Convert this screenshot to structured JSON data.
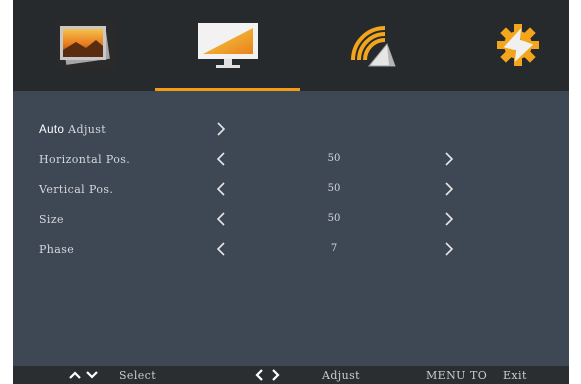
{
  "tabs": [
    {
      "icon": "picture-icon",
      "active": false
    },
    {
      "icon": "display-icon",
      "active": true
    },
    {
      "icon": "signal-icon",
      "active": false
    },
    {
      "icon": "settings-gear-icon",
      "active": false
    }
  ],
  "accent_color": "#f39c1a",
  "menu": {
    "auto_adjust": {
      "label_bold": "Auto",
      "label_rest": " Adjust"
    },
    "items": [
      {
        "label": "Horizontal  Pos.",
        "value": "50"
      },
      {
        "label": "Vertical  Pos.",
        "value": "50"
      },
      {
        "label": "Size",
        "value": "50"
      },
      {
        "label": "Phase",
        "value": "7"
      }
    ]
  },
  "footer": {
    "select_label": "Select",
    "adjust_label": "Adjust",
    "menu_word": "MENU",
    "to_word": "TO",
    "exit_word": "Exit"
  }
}
